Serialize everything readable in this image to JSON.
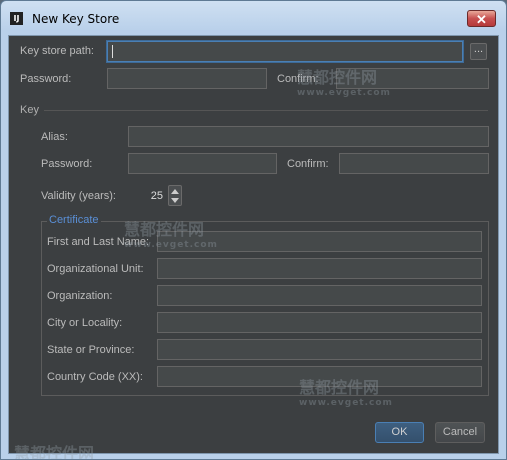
{
  "window": {
    "title": "New Key Store",
    "app_icon": "intellij-icon",
    "close_glyph": "✕"
  },
  "key_store": {
    "path_label": "Key store path:",
    "path_value": "",
    "browse_label": "...",
    "password_label": "Password:",
    "confirm_label": "Confirm:"
  },
  "key": {
    "section_label": "Key",
    "alias_label": "Alias:",
    "password_label": "Password:",
    "confirm_label": "Confirm:",
    "validity_label": "Validity (years):",
    "validity_value": "25"
  },
  "certificate": {
    "title": "Certificate",
    "fields": [
      {
        "label": "First and Last Name:"
      },
      {
        "label": "Organizational Unit:"
      },
      {
        "label": "Organization:"
      },
      {
        "label": "City or Locality:"
      },
      {
        "label": "State or Province:"
      },
      {
        "label": "Country Code (XX):"
      }
    ]
  },
  "buttons": {
    "ok": "OK",
    "cancel": "Cancel"
  },
  "watermark": {
    "text": "慧都控件网",
    "url": "www.evget.com"
  },
  "colors": {
    "background": "#3c3f41",
    "field": "#45494a",
    "focus": "#4a7fb4",
    "group_title": "#5a8fd6"
  }
}
